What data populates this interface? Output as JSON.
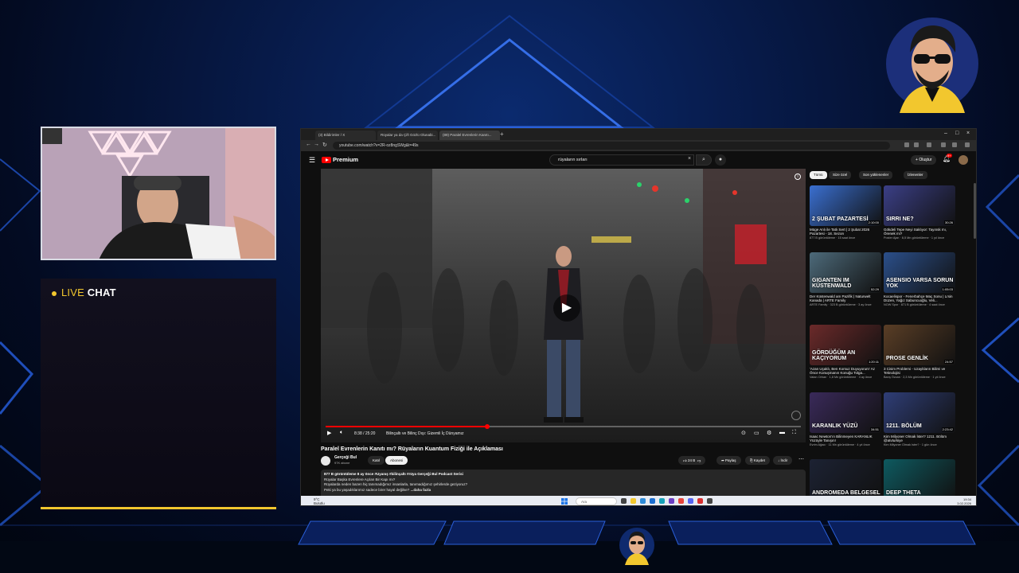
{
  "chat": {
    "live": "LIVE",
    "chat": "CHAT"
  },
  "browser": {
    "tabs": [
      "(3) Bildirimler / X",
      "Rüyalar ya da Çift Gözlü Olunabi...",
      "(89) Paralel Evrenlerin Kanıtı..."
    ],
    "url": "youtube.com/watch?v=2R-oz8ngSWg&t=49s"
  },
  "youtube": {
    "logo": "Premium",
    "search_value": "rüyaların sırları",
    "create_label": "Oluştur",
    "notifications_count": "9+",
    "player": {
      "time": "8:38 / 25:20",
      "chapter": "Bilinçaltı ve Bilinç Dışı: Gizemli İç Dünyamız",
      "progress": 0.34
    },
    "video": {
      "title": "Paralel Evrenlerin Kanıtı mı? Rüyaların Kuantum Fiziği ile Açıklaması",
      "channel": "Gerçeği Bul",
      "subscribers": "97K abone",
      "join_label": "Katıl",
      "subscribe_label": "Abonesi",
      "likes": "24 B",
      "share_label": "Paylaş",
      "clip_label": "Kaydet",
      "download_label": "İndir"
    },
    "description": {
      "meta": "877 B görüntüleme  8 ay önce  #Uyanış #bilinçaltı #rüya  Gerçeği Bul Podcast Serisi",
      "lines": [
        "Rüyalar Başka Evrenlere Açılan Bir Kapı mı?",
        "Rüyalarda neden bazen hiç tanımadığımız insanlarla, tanımadığımız şehirlerde geziyoruz?",
        "Peki ya bu yaşadıklarımız sadece birer hayal değilse?"
      ],
      "more": "...daha fazla"
    },
    "chips": [
      "Tümü",
      "Size özel",
      "Son yüklenenler",
      "İzlenenler"
    ],
    "recommendations": [
      {
        "overlay": "2 ŞUBAT PAZARTESİ",
        "duration": "2:10:00",
        "title": "Müge Anlı ile Tatlı Sert | 2 Şubat 2026 Pazartesi - 18. Sezon",
        "meta": "877 B görüntüleme · 15 saat önce",
        "color": "#3a6fd0"
      },
      {
        "overlay": "SIRRI NE?",
        "duration": "30:26",
        "title": "Gökdeli Tepe Neyi Saklıyor: Tayınsk mı, Örenek mi?",
        "meta": "Poster Ajan · 8,5 Mn görüntüleme · 1 yıl önce",
        "color": "#3b3f86"
      },
      {
        "overlay": "GIGANTEN IM KÜSTENWALD",
        "duration": "52:29",
        "title": "Der Küstenwald am Pazifik | Naturwelt Kanada | ARTE Family",
        "meta": "ARTE Family · 323 B görüntüleme · 3 ay önce",
        "color": "#4d6a7a"
      },
      {
        "overlay": "ASENSIO VARSA SORUN YOK",
        "duration": "1:05:03",
        "title": "Kocaelispor - Fenerbahçe Maç Sonu | Lrsin Düzen, Yağız Sabuncuoğlu, Veli...",
        "meta": "NOW Spor · 871 B görüntüleme · 4 saat önce",
        "color": "#2b4f8a"
      },
      {
        "overlay": "GÖRDÜĞÜM AN KAÇIYORUM",
        "duration": "1:20:11",
        "title": "'Azan Uçaklı, Ben Korsuz Duyuyorum' Az Önce Konuşmanın Konuğu Tolga...",
        "meta": "Vatan Orhan · 1,8 Mn görüntüleme · 4 ay önce",
        "color": "#6b2a2a"
      },
      {
        "overlay": "PROSE GENLİK",
        "duration": "24:57",
        "title": "3 Cisim Problemi - Uzaylıların Bilimi ve Teknolojisi",
        "meta": "Barış Özcan · 2,3 Mn görüntüleme · 1 yıl önce",
        "color": "#5a3e26"
      },
      {
        "overlay": "KARANLIK YÜZÜ",
        "duration": "34:51",
        "title": "Isaac Newton'ın Bilinmeyen KARANLIK Yüzüyle Tanışın!",
        "meta": "Evrim Ağacı · 11 Mn görüntüleme · 4 yıl önce",
        "color": "#3a2a5a"
      },
      {
        "overlay": "1211. BÖLÜM",
        "duration": "2:23:42",
        "title": "Kim Milyoner Olmak İster? 1211. Bölüm @atvturkiye",
        "meta": "Kim Milyoner Olmak İster? · 1 gün önce",
        "color": "#2f3e77"
      },
      {
        "overlay": "ANDROMEDA BELGESEL",
        "duration": "",
        "title": "",
        "meta": "",
        "color": "#1c2233"
      },
      {
        "overlay": "DEEP THETA",
        "duration": "",
        "title": "",
        "meta": "",
        "color": "#0e5a60"
      }
    ]
  },
  "taskbar": {
    "weather": "9°C",
    "weather_sub": "Bulutlu",
    "search_placeholder": "Ara",
    "time": "19:34",
    "date": "3.02.2026"
  }
}
